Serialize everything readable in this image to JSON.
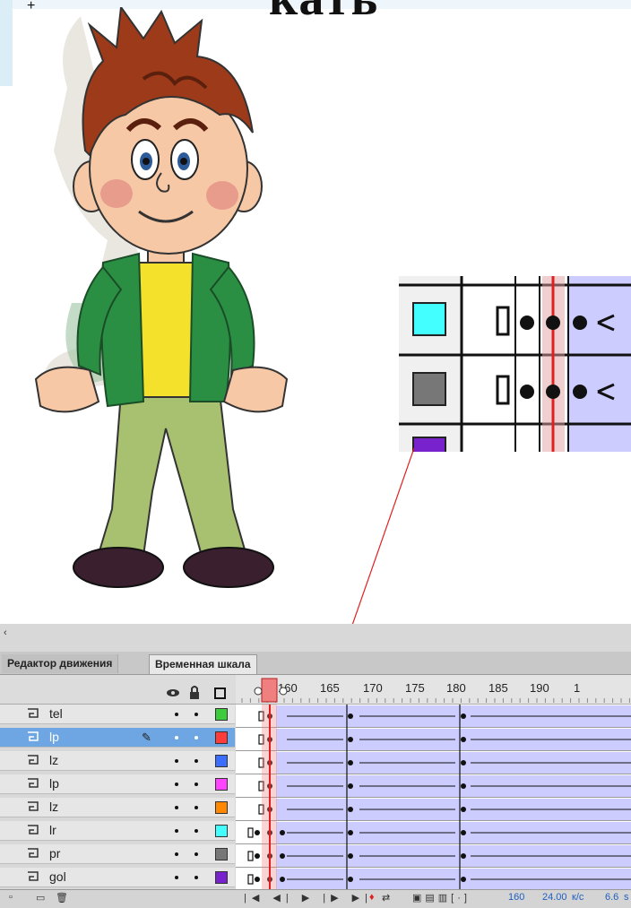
{
  "slide": {
    "title_fragment": "кать"
  },
  "colors": {
    "selected_layer": "#6ea6e4",
    "tween_span": "#ccccff",
    "playhead": "#e02020"
  },
  "timeline": {
    "tabs": [
      {
        "label": "Редактор движения",
        "active": false
      },
      {
        "label": "Временная шкала",
        "active": true
      }
    ],
    "header_icons": [
      "eye-icon",
      "lock-icon",
      "outline-icon"
    ],
    "ruler_labels": [
      "160",
      "165",
      "170",
      "175",
      "180",
      "185",
      "190",
      "1"
    ],
    "current_frame_marker": "160",
    "layers": [
      {
        "name": "tel",
        "color": "#3ccc3c",
        "selected": false
      },
      {
        "name": "lp",
        "color": "#ff3b3b",
        "selected": true
      },
      {
        "name": "lz",
        "color": "#3b6dff",
        "selected": false
      },
      {
        "name": "lp",
        "color": "#ff44ff",
        "selected": false
      },
      {
        "name": "lz",
        "color": "#ff8800",
        "selected": false
      },
      {
        "name": "lr",
        "color": "#44ffff",
        "selected": false
      },
      {
        "name": "pr",
        "color": "#777777",
        "selected": false
      },
      {
        "name": "gol",
        "color": "#7722cc",
        "selected": false
      }
    ],
    "status": {
      "frame": "160",
      "fps": "24.00",
      "fps_unit": "к/с",
      "time": "6.6",
      "time_unit": "s"
    }
  },
  "zoom_inset": {
    "swatch_colors": [
      "#44ffff",
      "#777777",
      "#7722cc"
    ]
  }
}
